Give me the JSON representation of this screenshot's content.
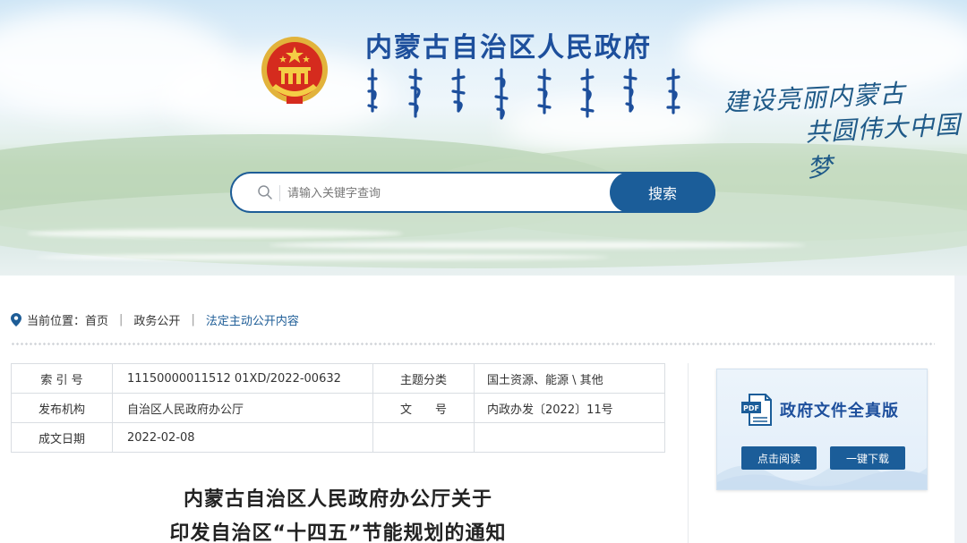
{
  "header": {
    "site_title": "内蒙古自治区人民政府",
    "slogan_line1": "建设亮丽内蒙古",
    "slogan_line2": "共圆伟大中国梦",
    "emblem_icon": "national-emblem-icon"
  },
  "search": {
    "placeholder": "请输入关键字查询",
    "value": "",
    "button_label": "搜索",
    "icon": "search-icon"
  },
  "breadcrumb": {
    "prefix": "当前位置：",
    "items": [
      "首页",
      "政务公开",
      "法定主动公开内容"
    ],
    "separator": "|"
  },
  "metadata": {
    "rows": [
      {
        "k1": "索 引 号",
        "v1": "11150000011512 01XD/2022-00632",
        "k2": "主题分类",
        "v2": "国土资源、能源 \\ 其他"
      },
      {
        "k1": "发布机构",
        "v1": "自治区人民政府办公厅",
        "k2": "文　　号",
        "v2": "内政办发〔2022〕11号"
      },
      {
        "k1": "成文日期",
        "v1": "2022-02-08",
        "k2": "",
        "v2": ""
      }
    ]
  },
  "document": {
    "title_line1": "内蒙古自治区人民政府办公厅关于",
    "title_line2": "印发自治区“十四五”节能规划的通知"
  },
  "pdf_card": {
    "title": "政府文件全真版",
    "icon": "pdf-file-icon",
    "read_label": "点击阅读",
    "download_label": "一键下载"
  },
  "colors": {
    "brand_blue": "#1b5d99",
    "title_blue": "#1d4f9c",
    "text": "#333333"
  }
}
